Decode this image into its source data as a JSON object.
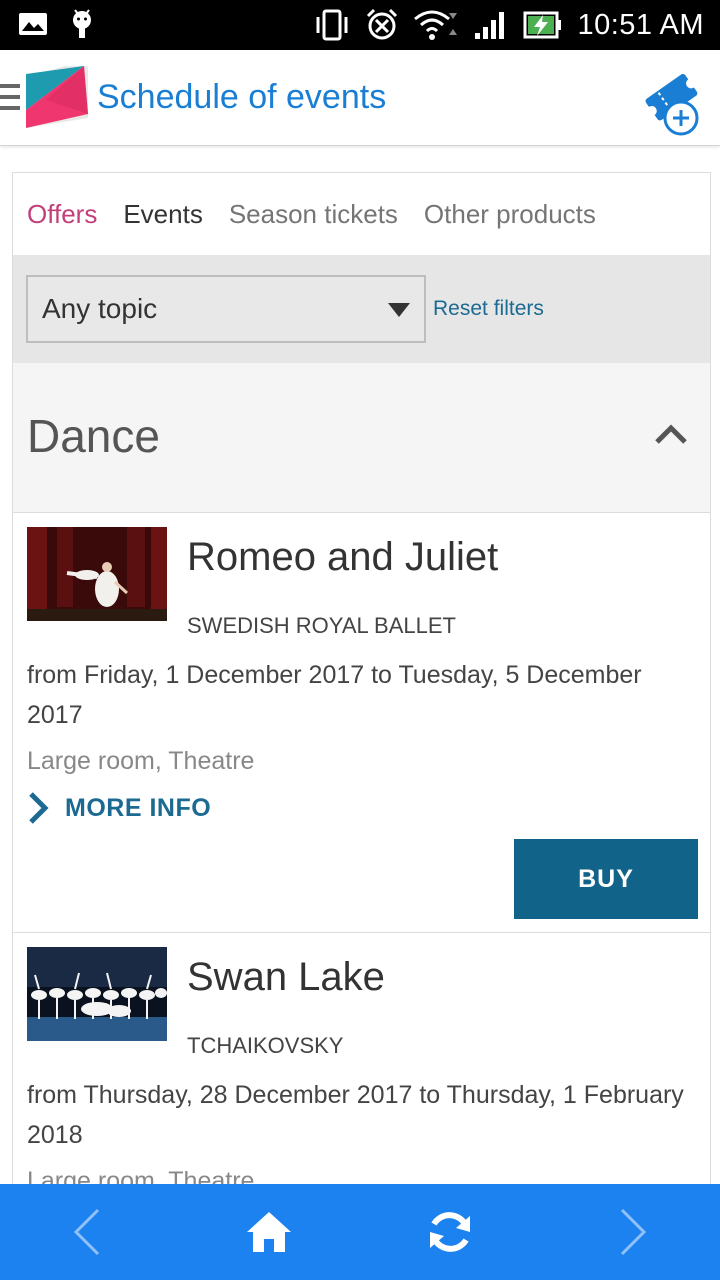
{
  "status_bar": {
    "time": "10:51 AM",
    "icons": [
      "image-icon",
      "android-debug-icon",
      "vibrate-icon",
      "alarm-icon",
      "wifi-icon",
      "signal-icon",
      "battery-charging-icon"
    ]
  },
  "app_bar": {
    "title": "Schedule of events",
    "icons": [
      "hamburger-menu-icon",
      "app-logo",
      "add-ticket-icon"
    ]
  },
  "tabs": [
    {
      "label": "Offers"
    },
    {
      "label": "Events"
    },
    {
      "label": "Season tickets"
    },
    {
      "label": "Other products"
    }
  ],
  "filters": {
    "topic_select": "Any topic",
    "reset_label": "Reset filters"
  },
  "section": {
    "title": "Dance"
  },
  "events": [
    {
      "title": "Romeo and Juliet",
      "subtitle": "SWEDISH ROYAL BALLET",
      "dates": "from Friday, 1 December 2017 to Tuesday, 5 December 2017",
      "venue": "Large room, Theatre",
      "more_info": "MORE INFO",
      "buy": "BUY"
    },
    {
      "title": "Swan Lake",
      "subtitle": "TCHAIKOVSKY",
      "dates": "from Thursday, 28 December 2017 to Thursday, 1 February 2018",
      "venue": "Large room, Theatre"
    }
  ],
  "bottom_nav": {
    "icons": [
      "back-icon",
      "home-icon",
      "refresh-icon",
      "forward-icon"
    ]
  },
  "colors": {
    "accent_blue": "#1a7fd4",
    "nav_blue": "#1c82f0",
    "buy_blue": "#12638a",
    "offers_pink": "#c33f7b"
  }
}
